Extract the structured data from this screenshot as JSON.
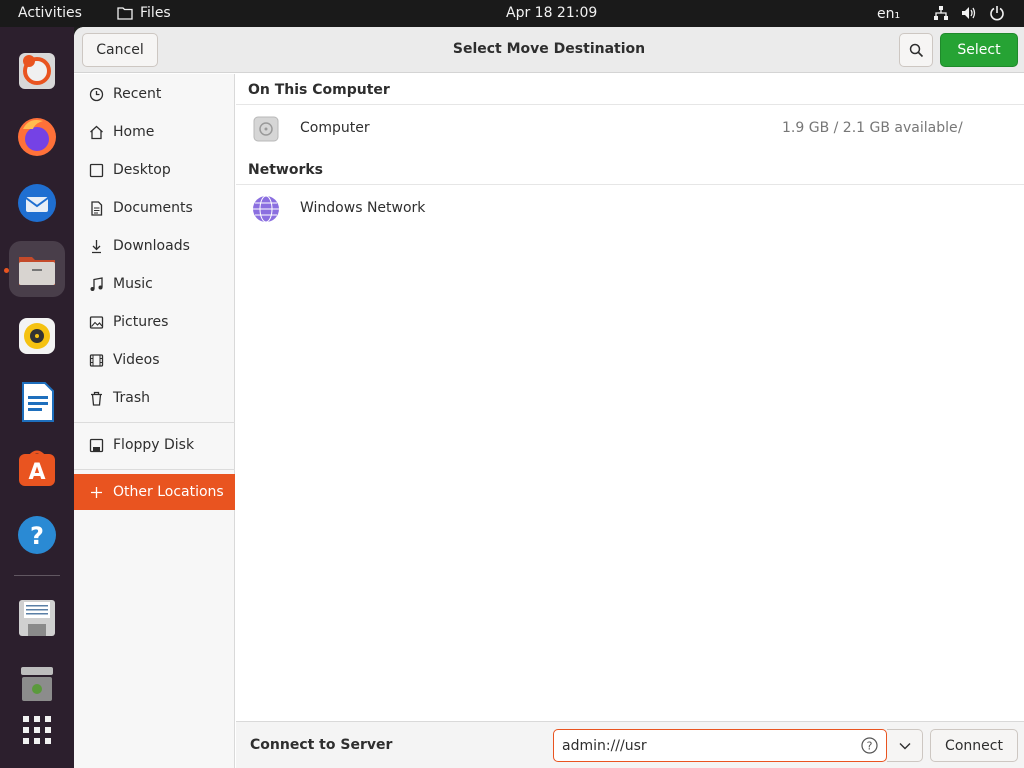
{
  "topbar": {
    "activities": "Activities",
    "app_name": "Files",
    "clock": "Apr 18  21:09",
    "language": "en₁"
  },
  "dock": {
    "items": [
      "disk-usage-analyzer-icon",
      "firefox-icon",
      "thunderbird-icon",
      "files-icon",
      "rhythmbox-icon",
      "libreoffice-writer-icon",
      "app-center-icon",
      "help-icon",
      "floppy-disk-icon",
      "trash-icon",
      "app-grid-icon"
    ],
    "active_item": "files-icon"
  },
  "dialog": {
    "title": "Select Move Destination",
    "cancel_label": "Cancel",
    "select_label": "Select"
  },
  "sidebar": {
    "items": [
      {
        "label": "Recent",
        "icon": "clock-icon"
      },
      {
        "label": "Home",
        "icon": "home-icon"
      },
      {
        "label": "Desktop",
        "icon": "desktop-icon"
      },
      {
        "label": "Documents",
        "icon": "document-icon"
      },
      {
        "label": "Downloads",
        "icon": "download-icon"
      },
      {
        "label": "Music",
        "icon": "music-icon"
      },
      {
        "label": "Pictures",
        "icon": "pictures-icon"
      },
      {
        "label": "Videos",
        "icon": "videos-icon"
      },
      {
        "label": "Trash",
        "icon": "trash-icon"
      },
      {
        "label": "Floppy Disk",
        "icon": "floppy-icon"
      },
      {
        "label": "Other Locations",
        "icon": "plus-icon",
        "active": true
      }
    ]
  },
  "main": {
    "sections": [
      {
        "title": "On This Computer",
        "rows": [
          {
            "name": "Computer",
            "available": "1.9 GB / 2.1 GB available",
            "mount": "/",
            "icon": "hard-drive-icon"
          }
        ]
      },
      {
        "title": "Networks",
        "rows": [
          {
            "name": "Windows Network",
            "icon": "network-icon"
          }
        ]
      }
    ]
  },
  "bottombar": {
    "label": "Connect to Server",
    "server_value": "admin:///usr",
    "connect_label": "Connect"
  },
  "colors": {
    "accent": "#e95420",
    "select_button": "#26a334",
    "dock_bg": "#2c1f2d",
    "topbar_bg": "#1a1a1a"
  }
}
